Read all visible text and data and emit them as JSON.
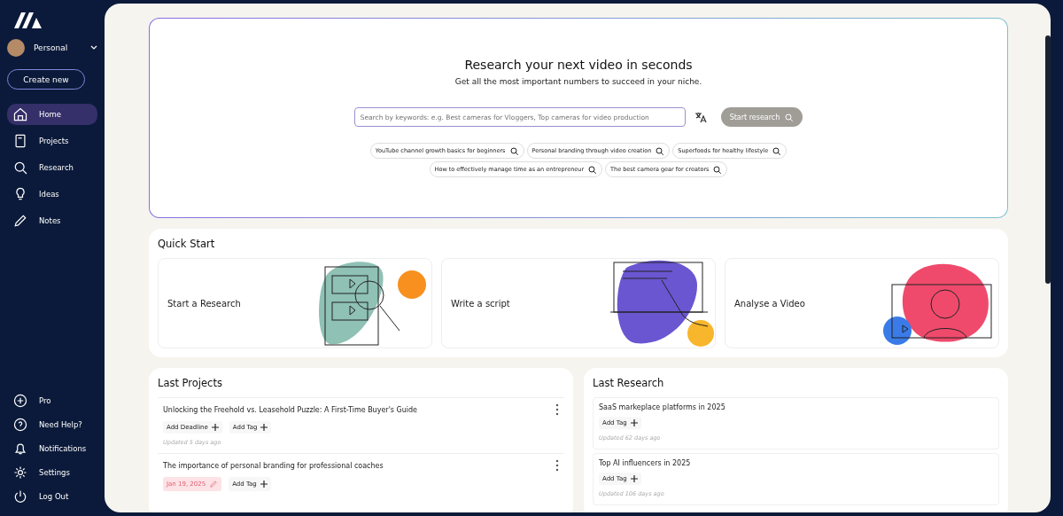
{
  "sidebar": {
    "profile": {
      "name": "Personal"
    },
    "create_button": "Create new",
    "nav": [
      {
        "label": "Home",
        "selected": true
      },
      {
        "label": "Projects",
        "selected": false
      },
      {
        "label": "Research",
        "selected": false
      },
      {
        "label": "Ideas",
        "selected": false
      },
      {
        "label": "Notes",
        "selected": false
      }
    ],
    "bottom_nav": [
      {
        "label": "Pro"
      },
      {
        "label": "Need Help?"
      },
      {
        "label": "Notifications"
      },
      {
        "label": "Settings"
      },
      {
        "label": "Log Out"
      }
    ]
  },
  "hero": {
    "title": "Research your next video in seconds",
    "subtitle": "Get all the most important numbers to succeed in your niche.",
    "search": {
      "placeholder": "Search by keywords: e.g. Best cameras for Vloggers, Top cameras for video production"
    },
    "button": "Start research",
    "suggestions": [
      "YouTube channel growth basics for beginners",
      "Personal branding through video creation",
      "Superfoods for healthy lifestyle",
      "How to effectively manage time as an entrepreneur",
      "The best camera gear for creators"
    ]
  },
  "quick_start": {
    "title": "Quick Start",
    "cards": [
      {
        "label": "Start a Research",
        "kind": "research"
      },
      {
        "label": "Write a script",
        "kind": "script"
      },
      {
        "label": "Analyse a Video",
        "kind": "video"
      }
    ]
  },
  "last_projects": {
    "title": "Last Projects",
    "items": [
      {
        "title": "Unlocking the Freehold vs. Leasehold Puzzle: A First-Time Buyer's Guide",
        "deadline": {
          "kind": "add",
          "label": "Add Deadline"
        },
        "tag": "Add Tag",
        "updated": "Updated 5 days ago"
      },
      {
        "title": "The importance of personal branding for professional coaches",
        "deadline": {
          "kind": "date",
          "label": "Jan 19, 2025"
        },
        "tag": "Add Tag"
      }
    ]
  },
  "last_research": {
    "title": "Last Research",
    "items": [
      {
        "title": "SaaS markeplace platforms in 2025",
        "tag": "Add Tag",
        "updated": "Updated 62 days ago"
      },
      {
        "title": "Top AI influencers in 2025",
        "tag": "Add Tag",
        "updated": "Updated 106 days ago"
      }
    ]
  }
}
